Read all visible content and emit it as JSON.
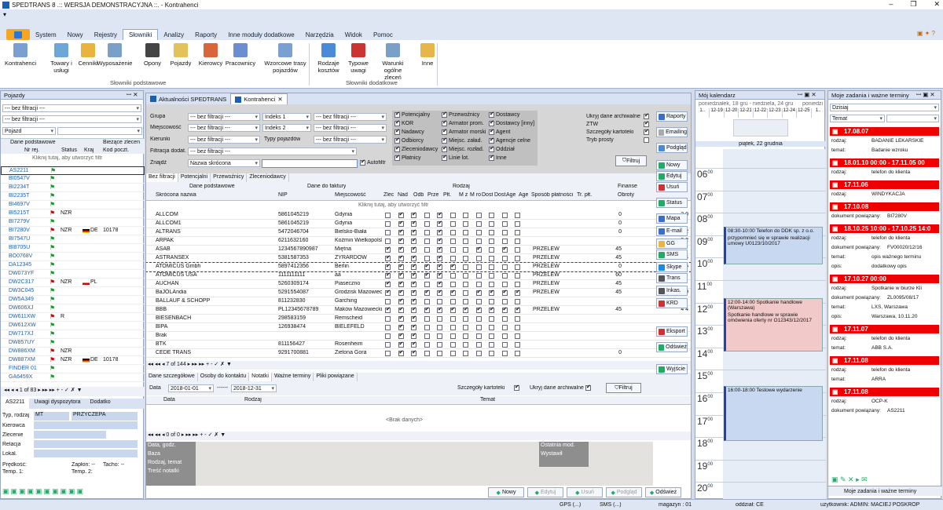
{
  "window": {
    "title": "SPEDTRANS 8 .:: WERSJA DEMONSTRACYJNA ::. - Kontrahenci"
  },
  "menu": [
    "System",
    "Nowy",
    "Rejestry",
    "Słowniki",
    "Analizy",
    "Raporty",
    "Inne moduły dodatkowe",
    "Narzędzia",
    "Widok",
    "Pomoc"
  ],
  "ribbon": {
    "basic": [
      "Kontrahenci",
      "Towary i usługi",
      "Cenniki",
      "Wyposażenie",
      "Opony",
      "Pojazdy",
      "Kierowcy",
      "Pracownicy",
      "Wzorcowe trasy pojazdów"
    ],
    "basic_group": "Słowniki podstawowe",
    "extra": [
      "Rodzaje kosztów",
      "Typowe uwagi",
      "Warunki ogólne zleceń",
      "Inne"
    ],
    "extra_group": "Słowniki dodatkowe"
  },
  "vehicles": {
    "title": "Pojazdy",
    "filter1": "--- bez filtracji ---",
    "filter2": "--- bez filtracji ---",
    "field": "Pojazd",
    "h1": "Dane podstawowe",
    "h2": "Bieżące zlecen",
    "cols": [
      "Nr rej.",
      "Status",
      "Kraj",
      "Kod poczt."
    ],
    "hint": "Kliknij tutaj, aby utworzyć filtr",
    "rows": [
      {
        "nr": "AS2211",
        "st": "",
        "kraj": "",
        "kod": "",
        "flag": "green"
      },
      {
        "nr": "BI0547V",
        "st": "",
        "kraj": "",
        "kod": "",
        "flag": "green"
      },
      {
        "nr": "BI2234T",
        "st": "",
        "kraj": "",
        "kod": "",
        "flag": "green"
      },
      {
        "nr": "BI2235T",
        "st": "",
        "kraj": "",
        "kod": "",
        "flag": "green"
      },
      {
        "nr": "BI4697V",
        "st": "",
        "kraj": "",
        "kod": "",
        "flag": "green"
      },
      {
        "nr": "BI5215T",
        "st": "NZR",
        "kraj": "",
        "kod": "",
        "flag": "red"
      },
      {
        "nr": "BI7279V",
        "st": "",
        "kraj": "",
        "kod": "",
        "flag": "green"
      },
      {
        "nr": "BI7280V",
        "st": "NZR",
        "kraj": "DE",
        "kod": "10178",
        "flag": "red"
      },
      {
        "nr": "BI7547U",
        "st": "",
        "kraj": "",
        "kod": "",
        "flag": "green"
      },
      {
        "nr": "BI8705U",
        "st": "",
        "kraj": "",
        "kod": "",
        "flag": "green"
      },
      {
        "nr": "BO0768V",
        "st": "",
        "kraj": "",
        "kod": "",
        "flag": "green"
      },
      {
        "nr": "DA12345",
        "st": "",
        "kraj": "",
        "kod": "",
        "flag": "green"
      },
      {
        "nr": "DW073YF",
        "st": "",
        "kraj": "",
        "kod": "",
        "flag": "green"
      },
      {
        "nr": "DW2C317",
        "st": "NZR",
        "kraj": "PL",
        "kod": "",
        "flag": "red"
      },
      {
        "nr": "DW3C045",
        "st": "",
        "kraj": "",
        "kod": "",
        "flag": "green"
      },
      {
        "nr": "DW5A349",
        "st": "",
        "kraj": "",
        "kod": "",
        "flag": "green"
      },
      {
        "nr": "DW606XJ",
        "st": "",
        "kraj": "",
        "kod": "",
        "flag": "green"
      },
      {
        "nr": "DW611XW",
        "st": "R",
        "kraj": "",
        "kod": "",
        "flag": "red"
      },
      {
        "nr": "DW612XW",
        "st": "",
        "kraj": "",
        "kod": "",
        "flag": "green"
      },
      {
        "nr": "DW717XJ",
        "st": "",
        "kraj": "",
        "kod": "",
        "flag": "green"
      },
      {
        "nr": "DW857UY",
        "st": "",
        "kraj": "",
        "kod": "",
        "flag": "green"
      },
      {
        "nr": "DW886XM",
        "st": "NZR",
        "kraj": "",
        "kod": "",
        "flag": "red"
      },
      {
        "nr": "DW887XM",
        "st": "NZR",
        "kraj": "DE",
        "kod": "10178",
        "flag": "red"
      },
      {
        "nr": "FINDER 01",
        "st": "",
        "kraj": "",
        "kod": "",
        "flag": "green"
      },
      {
        "nr": "GA6459X",
        "st": "",
        "kraj": "",
        "kod": "",
        "flag": "green"
      }
    ],
    "nav": "1 of 83",
    "tabs": [
      "AS2211",
      "Uwagi dyspozytora",
      "Dodatko"
    ],
    "detail": {
      "typ_label": "Typ, rodzaj",
      "typ": "MT",
      "rodzaj": "PRZYCZEPA",
      "labels": [
        "Kierowca",
        "Zlecenie",
        "Relacja",
        "Lokal."
      ],
      "predkosc": "Prędkość:",
      "zaplon": "Zapłon: --",
      "tacho": "Tacho: --",
      "temp1": "Temp. 1:",
      "temp2": "Temp. 2:"
    }
  },
  "tabs": [
    "Aktualności SPEDTRANS",
    "Kontrahenci"
  ],
  "filters": {
    "grupa": "Grupa",
    "miejscowosc": "Miejscowość",
    "kierunki": "Kierunki",
    "filtr_dodat": "Filtracja dodat.",
    "znajdz": "Znajdź",
    "none": "--- bez filtracji ---",
    "indeks1": "Indeks 1",
    "indeks2": "Indeks 2",
    "typy": "Typy pojazdów",
    "nazwa": "Nazwa skrócona",
    "autofiltr": "Autofiltr",
    "types": [
      [
        "Potencjalny",
        "Przewoźnicy",
        "Dostawcy"
      ],
      [
        "KOR",
        "Armator prom.",
        "Dostawcy [inny]"
      ],
      [
        "Nadawcy",
        "Armator morski",
        "Agent"
      ],
      [
        "Odbiorcy",
        "Miejsc. załad.",
        "Agencje celne"
      ],
      [
        "Zleceniodawcy",
        "Miejsc. rozład.",
        "Oddział"
      ],
      [
        "Płatnicy",
        "Linie lot.",
        "Inne"
      ]
    ],
    "right": [
      "Ukryj dane archiwalne",
      "ZTW",
      "Szczegóły kartoteki",
      "Tryb prosty"
    ],
    "filtruj": "Filtruj"
  },
  "subtabs": [
    "Bez filtracji",
    "Potencjalni",
    "Przewoźnicy",
    "Zleceniodawcy"
  ],
  "grid": {
    "g1": "Dane podstawowe",
    "g2": "Dane do faktury",
    "g3": "Rodzaj",
    "g4": "Finanse",
    "cols": [
      "Skrócona nazwa",
      "NIP",
      "Miejscowość",
      "Zlec",
      "Nad",
      "Odb",
      "Prze",
      "Płt.",
      "M z",
      "M ro",
      "Dost",
      "Dost.",
      "Age",
      "Age",
      "Sposób płatności",
      "Tr. płt.",
      "Obroty"
    ],
    "hint": "Kliknij tutaj, aby utworzyć filtr",
    "rows": [
      {
        "n": "ALLCOM",
        "nip": "5861045219",
        "m": "Gdynia",
        "c": [
          0,
          1,
          1,
          0,
          1,
          0,
          0,
          0,
          0,
          0,
          0
        ],
        "sp": "",
        "tr": "0",
        "ob": "3 0"
      },
      {
        "n": "ALLCOM1",
        "nip": "5861045219",
        "m": "Gdynia",
        "c": [
          0,
          1,
          1,
          0,
          1,
          0,
          0,
          0,
          0,
          0,
          0
        ],
        "sp": "",
        "tr": "0",
        "ob": ""
      },
      {
        "n": "ALTRANS",
        "nip": "5472046704",
        "m": "Bielsko-Biała",
        "c": [
          0,
          1,
          1,
          0,
          1,
          0,
          0,
          0,
          0,
          0,
          0
        ],
        "sp": "",
        "tr": "0",
        "ob": "4 2"
      },
      {
        "n": "ARPAK",
        "nip": "6211632160",
        "m": "Koźmin Wielkopolski",
        "c": [
          0,
          1,
          1,
          0,
          1,
          0,
          0,
          0,
          0,
          0,
          0
        ],
        "sp": "",
        "tr": "",
        "ob": "6 2"
      },
      {
        "n": "ASAB",
        "nip": "1234567890987",
        "m": "Miętna",
        "c": [
          1,
          1,
          1,
          0,
          1,
          0,
          0,
          1,
          0,
          1,
          0
        ],
        "sp": "PRZELEW",
        "tr": "45",
        "ob": ""
      },
      {
        "n": "ASTRANSEX",
        "nip": "5381587353",
        "m": "ŻYRARDÓW",
        "c": [
          1,
          1,
          1,
          0,
          1,
          0,
          0,
          0,
          0,
          0,
          0
        ],
        "sp": "PRZELEW",
        "tr": "45",
        "ob": "11 4"
      },
      {
        "n": "ATOMICUS Gmbh",
        "nip": "5897412356",
        "m": "Berlin",
        "c": [
          1,
          1,
          1,
          1,
          1,
          1,
          0,
          0,
          0,
          0,
          0
        ],
        "sp": "PRZELEW",
        "tr": "0",
        "ob": "8 6"
      },
      {
        "n": "ATOMICUS USA",
        "nip": "1111111111",
        "m": "aa",
        "c": [
          1,
          1,
          1,
          1,
          1,
          0,
          0,
          0,
          0,
          0,
          0
        ],
        "sp": "PRZELEW",
        "tr": "60",
        "ob": ""
      },
      {
        "n": "AUCHAN",
        "nip": "5260309174",
        "m": "Piaseczno",
        "c": [
          1,
          1,
          1,
          0,
          1,
          0,
          0,
          0,
          0,
          0,
          0
        ],
        "sp": "PRZELEW",
        "tr": "45",
        "ob": ""
      },
      {
        "n": "BaJOLAndia",
        "nip": "5291554087",
        "m": "Grodzisk Mazowiecki",
        "c": [
          1,
          1,
          1,
          1,
          1,
          1,
          0,
          1,
          1,
          1,
          1
        ],
        "sp": "PRZELEW",
        "tr": "45",
        "ob": "1 0"
      },
      {
        "n": "BALLAUF & SCHOPP",
        "nip": "811232830",
        "m": "Garching",
        "c": [
          0,
          1,
          1,
          0,
          0,
          0,
          0,
          0,
          0,
          0,
          0
        ],
        "sp": "",
        "tr": "",
        "ob": ""
      },
      {
        "n": "BBB",
        "nip": "PL12345678789",
        "m": "Maków Mazowiecki",
        "c": [
          1,
          1,
          1,
          1,
          1,
          1,
          1,
          1,
          1,
          1,
          1
        ],
        "sp": "PRZELEW",
        "tr": "45",
        "ob": "4 4"
      },
      {
        "n": "BIESENBACH",
        "nip": "298583159",
        "m": "Remscheid",
        "c": [
          0,
          1,
          1,
          0,
          0,
          0,
          0,
          0,
          0,
          0,
          0
        ],
        "sp": "",
        "tr": "",
        "ob": ""
      },
      {
        "n": "BIPA",
        "nip": "126938474",
        "m": "BIELEFELD",
        "c": [
          0,
          1,
          1,
          0,
          0,
          0,
          0,
          0,
          0,
          0,
          0
        ],
        "sp": "",
        "tr": "",
        "ob": ""
      },
      {
        "n": "Brak",
        "nip": "",
        "m": "",
        "c": [
          0,
          1,
          1,
          0,
          0,
          0,
          0,
          0,
          0,
          0,
          0
        ],
        "sp": "",
        "tr": "",
        "ob": ""
      },
      {
        "n": "BTK",
        "nip": "811156427",
        "m": "Rosenheim",
        "c": [
          0,
          1,
          1,
          0,
          0,
          0,
          0,
          0,
          0,
          0,
          0
        ],
        "sp": "",
        "tr": "",
        "ob": ""
      },
      {
        "n": "CEDE TRANS",
        "nip": "9291700881",
        "m": "Zielona Gora",
        "c": [
          0,
          1,
          1,
          0,
          0,
          0,
          0,
          0,
          0,
          0,
          0
        ],
        "sp": "",
        "tr": "0",
        "ob": ""
      }
    ],
    "nav": "7 of 144"
  },
  "lower": {
    "tabs": [
      "Dane szczegółowe",
      "Osoby do kontaktu",
      "Notatki",
      "Ważne terminy",
      "Pliki powiązane"
    ],
    "data_label": "Data",
    "from": "2018-01-01",
    "sep": "------",
    "to": "2018-12-31",
    "szczegoly": "Szczegóły kartoteki",
    "ukryj": "Ukryj dane archiwalne",
    "filtruj": "Filtruj",
    "cols": [
      "Data",
      "Rodzaj",
      "Temat"
    ],
    "empty": "<Brak danych>",
    "nav": "0 of 0",
    "left_labels": [
      "Data, godz.",
      "Baza",
      "Rodzaj, temat",
      "Treść notatki"
    ],
    "right_labels": [
      "Ostatnia mod.",
      "Wystawił"
    ],
    "buttons": [
      "Nowy",
      "Edytuj",
      "Usuń",
      "Podgląd",
      "Odśwież"
    ]
  },
  "actions": [
    "Raporty",
    "Emailing",
    "Podgląd",
    "Nowy",
    "Edytuj",
    "Usuń",
    "Status",
    "Mapa",
    "E-mail",
    "GG",
    "SMS",
    "Skype",
    "Trans",
    "Inkas.",
    "KRD",
    "Eksport",
    "Odśwież",
    "Wyjście"
  ],
  "calendar": {
    "title": "Mój kalendarz",
    "range": "poniedziałek, 18 gru - niedziela, 24 gru",
    "range2": "poniedzi",
    "weeks": [
      "1..",
      "12-19",
      "12-20",
      "12-21",
      "12-22",
      "12-23",
      "12-24",
      "12-25",
      "1.."
    ],
    "day": "piątek, 22 grudnia",
    "hours": [
      "06",
      "07",
      "08",
      "09",
      "10",
      "11",
      "12",
      "13",
      "14",
      "15",
      "16",
      "17",
      "18",
      "19",
      "20"
    ],
    "events": [
      {
        "title": "08:30-10:00 Telefon do DDK sp. z o.o.",
        "body": "przypomnieć się w sprawie realizacji umowy U0123/10/2017",
        "color": "#c8d8f0"
      },
      {
        "title": "12:00-14:00 Spotkanie handlowe (Warszawa)",
        "body": "Spotkanie handlowe w sprawie omówienia oferty nr O12343/12/2017",
        "color": "#f2c9c9"
      },
      {
        "title": "16:00-18:00 Testowe wydarzenie",
        "body": "",
        "color": "#c8d8f0"
      }
    ]
  },
  "tasks": {
    "title": "Moje zadania i ważne terminy",
    "filter": "Dzisiaj",
    "sort": "Temat",
    "items": [
      {
        "head": "17.08.07",
        "lines": [
          [
            "rodzaj:",
            "BADANIE LEKARSKIE"
          ],
          [
            "temat:",
            "Badanie wzroku"
          ]
        ]
      },
      {
        "head": "18.01.10 00:00 - 17.11.05 00",
        "lines": [
          [
            "rodzaj:",
            "telefon do klienta"
          ]
        ]
      },
      {
        "head": "17.11.06",
        "lines": [
          [
            "rodzaj:",
            "WINDYKACJA"
          ]
        ]
      },
      {
        "head": "17.10.08",
        "lines": [
          [
            "dokument powiązany:",
            "BI7280V"
          ]
        ]
      },
      {
        "head": "18.10.25 10:00 - 17.10.25 14:0",
        "lines": [
          [
            "rodzaj:",
            "telefon do klienta"
          ],
          [
            "dokument powiązany:",
            "FV00020/12/16"
          ],
          [
            "temat:",
            "opis ważnego terminu"
          ],
          [
            "opis:",
            "dodatkowy opis"
          ]
        ]
      },
      {
        "head": "17.10.27 00:00",
        "lines": [
          [
            "rodzaj:",
            "Spotkanie w biurze Kli"
          ],
          [
            "dokument powiązany:",
            "ZL0095/08/17"
          ],
          [
            "temat:",
            "LXS, Warszawa"
          ],
          [
            "opis:",
            "Warszawa, 10.11.20"
          ]
        ]
      },
      {
        "head": "17.11.07",
        "lines": [
          [
            "rodzaj:",
            "telefon do klienta"
          ],
          [
            "temat:",
            "ABB S.A."
          ]
        ]
      },
      {
        "head": "17.11.08",
        "lines": [
          [
            "rodzaj:",
            "telefon do klienta"
          ],
          [
            "temat:",
            "ARRA"
          ]
        ]
      },
      {
        "head": "17.11.08",
        "lines": [
          [
            "rodzaj:",
            "OCP-K"
          ],
          [
            "dokument powiązany:",
            "AS2211"
          ]
        ]
      }
    ],
    "footer": "Moje zadania i ważne terminy"
  },
  "statusbar": {
    "gps": "GPS (...)",
    "sms": "SMS (...)",
    "magazyn": "magazyn : 01",
    "oddzial": "oddział: CE",
    "user": "użytkownik: ADMIN: MACIEJ POSKROP"
  }
}
